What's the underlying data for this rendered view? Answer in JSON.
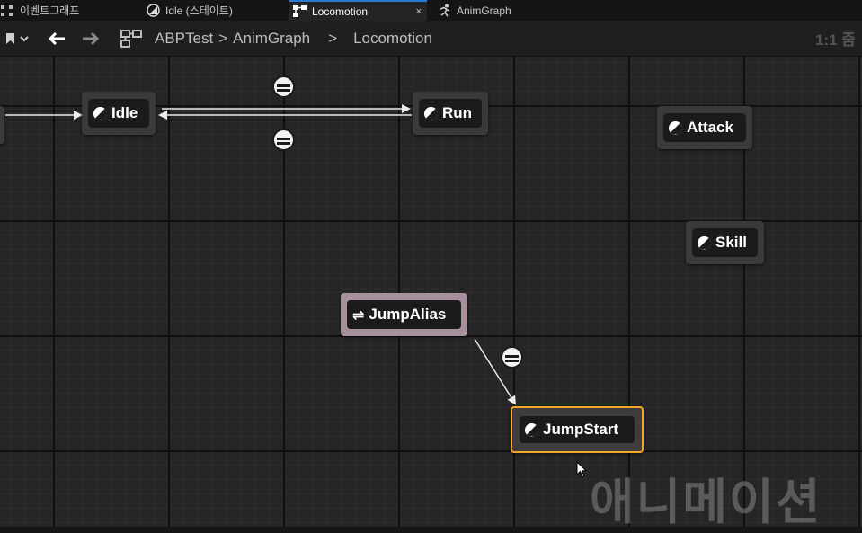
{
  "tabs": [
    {
      "label": "이벤트그래프",
      "icon": "graph-icon",
      "active": false
    },
    {
      "label": "Idle (스테이트)",
      "icon": "state-icon",
      "active": false
    },
    {
      "label": "Locomotion",
      "icon": "state-machine-icon",
      "active": true,
      "close": "×"
    },
    {
      "label": "AnimGraph",
      "icon": "running-man-icon",
      "active": false
    }
  ],
  "toolbar": {
    "breadcrumb": [
      "ABPTest",
      "AnimGraph",
      "Locomotion"
    ],
    "separator": ">",
    "zoom_label": "1:1 줌"
  },
  "nodes": {
    "idle": {
      "label": "Idle"
    },
    "run": {
      "label": "Run"
    },
    "attack": {
      "label": "Attack"
    },
    "skill": {
      "label": "Skill"
    },
    "jump_alias": {
      "label": "JumpAlias",
      "symbol": "⇌"
    },
    "jump_start": {
      "label": "JumpStart"
    }
  },
  "watermark": "애니메이션",
  "colors": {
    "selection": "#f5a623",
    "alias_node": "#a88f9d",
    "active_tab_accent": "#2a7bd4"
  }
}
